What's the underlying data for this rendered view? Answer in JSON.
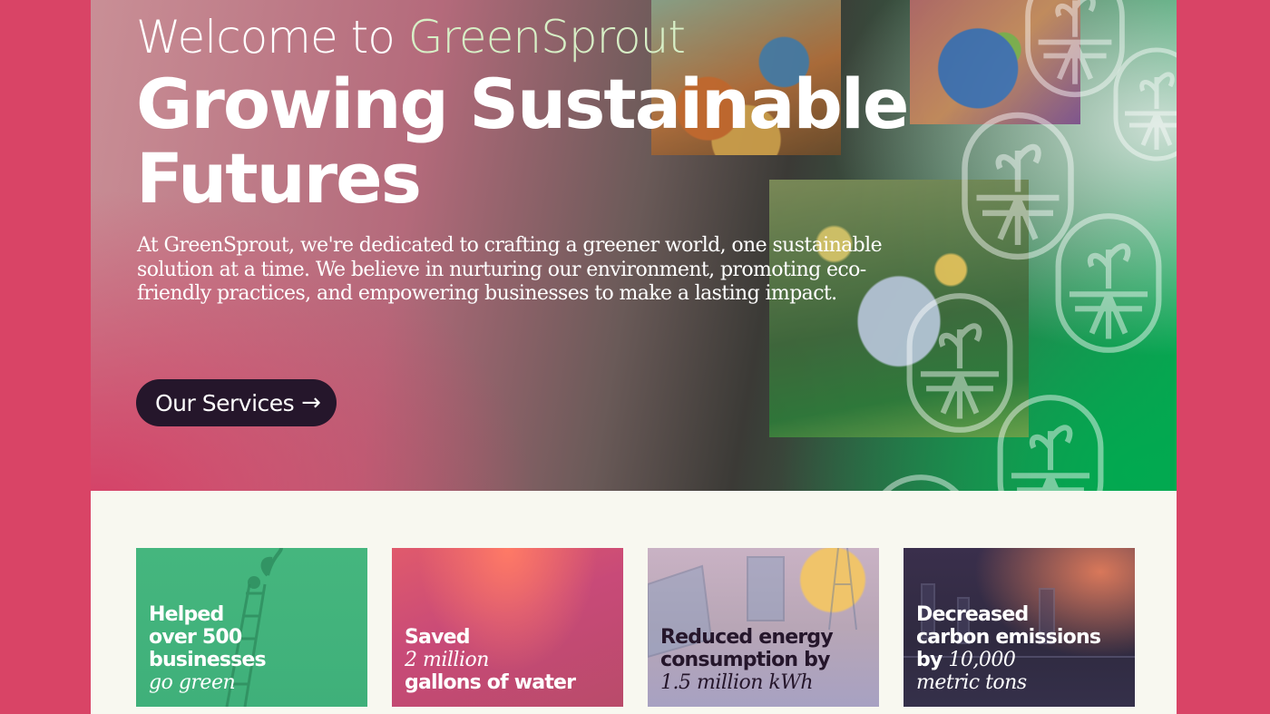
{
  "hero": {
    "welcome_prefix": "Welcome to ",
    "brand_name": "GreenSprout",
    "headline": "Growing Sustainable Futures",
    "intro": "At GreenSprout, we're dedicated to crafting a greener world, one sustainable solution at a time. We believe in nurturing our environment, promoting eco-friendly practices, and empowering businesses to make a lasting impact.",
    "cta_label": "Our Services",
    "cta_icon": "arrow-right-icon"
  },
  "stats": [
    {
      "line1": "Helped",
      "line2": "over 500",
      "line3": "businesses",
      "italic": "go green"
    },
    {
      "line1": "Saved",
      "italic": "2 million",
      "line3": "gallons of water"
    },
    {
      "line1": "Reduced energy",
      "line2": "consumption by",
      "italic": "1.5 million kWh"
    },
    {
      "line1": "Decreased",
      "line2": "carbon emissions",
      "prefix": "by ",
      "italic": "10,000",
      "italic2": "metric tons"
    }
  ],
  "colors": {
    "page_bg": "#d94466",
    "brand_accent": "#d7efc6",
    "button_bg": "#25162b",
    "hero_green": "#08a652",
    "card1_bg": "#45b67e"
  },
  "icons": [
    "sprout-emblem-icon",
    "arrow-right-icon"
  ]
}
